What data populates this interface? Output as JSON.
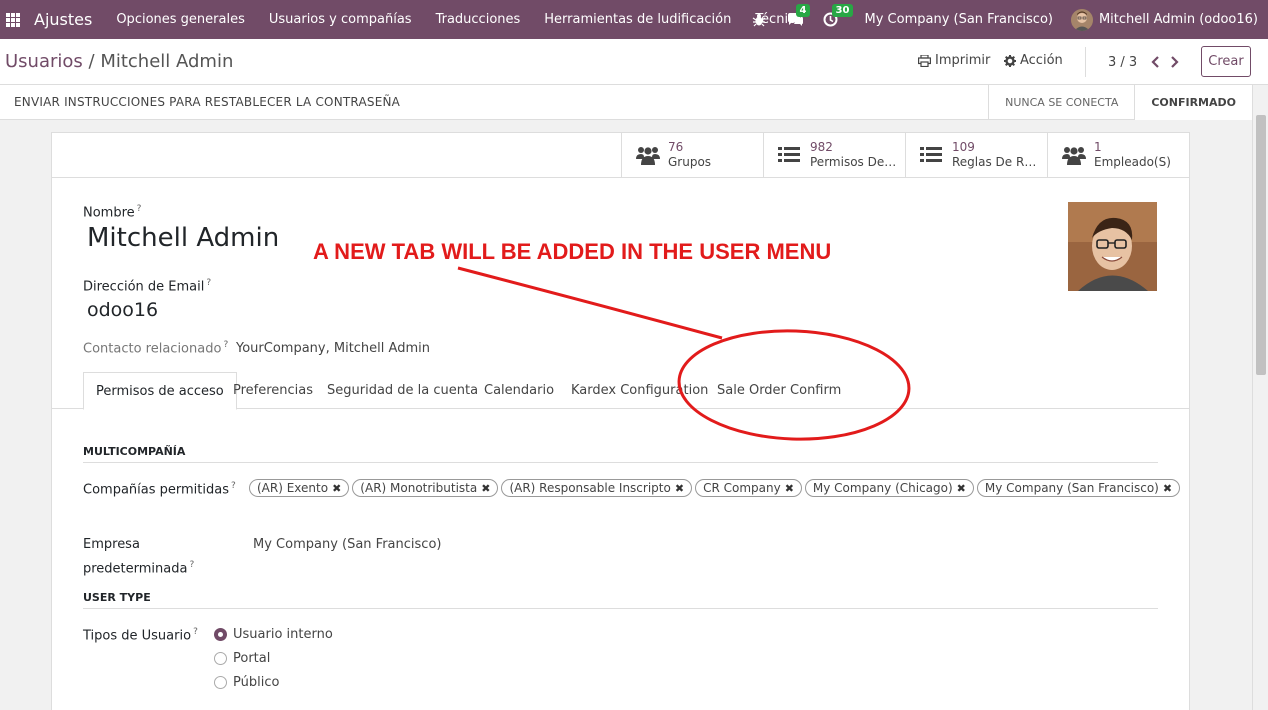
{
  "navbar": {
    "app_name": "Ajustes",
    "menu": [
      "Opciones generales",
      "Usuarios y compañías",
      "Traducciones",
      "Herramientas de ludificación",
      "Técnico"
    ],
    "messages_badge": "4",
    "activity_badge": "30",
    "company": "My Company (San Francisco)",
    "user": "Mitchell Admin (odoo16)",
    "accent": "#714b67"
  },
  "control": {
    "breadcrumb_parent": "Usuarios",
    "breadcrumb_sep": " / ",
    "breadcrumb_current": "Mitchell Admin",
    "print_label": "Imprimir",
    "action_label": "Acción",
    "pager": "3 / 3",
    "create_label": "Crear"
  },
  "statusbar": {
    "action": "ENVIAR INSTRUCCIONES PARA RESTABLECER LA CONTRASEÑA",
    "stages": [
      "NUNCA SE CONECTA",
      "CONFIRMADO"
    ]
  },
  "smart_buttons": [
    {
      "value": "76",
      "label": "Grupos",
      "icon": "users-icon"
    },
    {
      "value": "982",
      "label": "Permisos De…",
      "icon": "list-icon"
    },
    {
      "value": "109",
      "label": "Reglas De R…",
      "icon": "list-icon"
    },
    {
      "value": "1",
      "label": "Empleado(S)",
      "icon": "users-icon"
    }
  ],
  "form": {
    "name_label": "Nombre",
    "name_value": "Mitchell Admin",
    "email_label": "Dirección de Email",
    "email_value": "odoo16",
    "contact_label": "Contacto relacionado",
    "contact_value": "YourCompany, Mitchell Admin",
    "help_mark": "?"
  },
  "annotation": "A NEW TAB WILL BE ADDED IN THE USER MENU",
  "tabs": [
    "Permisos de acceso",
    "Preferencias",
    "Seguridad de la cuenta",
    "Calendario",
    "Kardex Configuration",
    "Sale Order Confirm"
  ],
  "access": {
    "multicompany_section": "MULTICOMPAÑÍA",
    "allowed_label": "Compañías permitidas",
    "allowed_companies": [
      "(AR) Exento",
      "(AR) Monotributista",
      "(AR) Responsable Inscripto",
      "CR Company",
      "My Company (Chicago)",
      "My Company (San Francisco)"
    ],
    "default_label_1": "Empresa",
    "default_label_2": "predeterminada",
    "default_value": "My Company (San Francisco)",
    "user_type_section": "USER TYPE",
    "user_type_label": "Tipos de Usuario",
    "user_types": [
      "Usuario interno",
      "Portal",
      "Público"
    ],
    "selected_user_type": "Usuario interno"
  }
}
